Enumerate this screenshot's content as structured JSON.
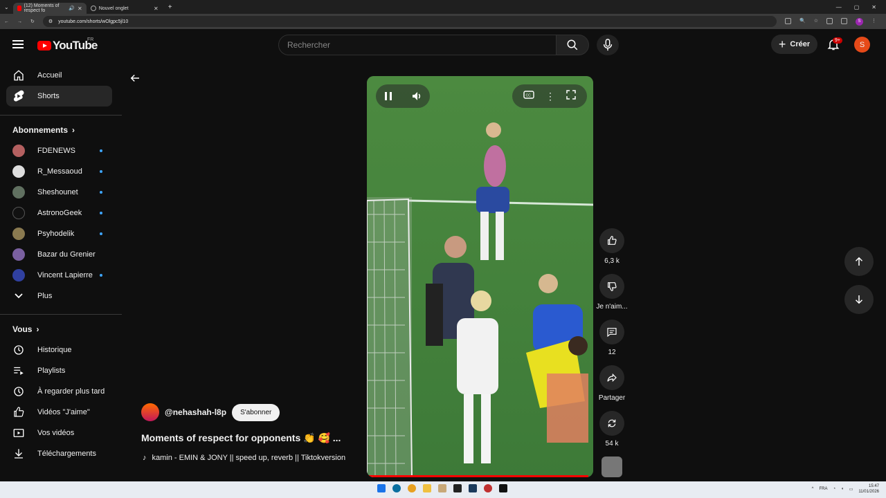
{
  "browser": {
    "tabs": [
      {
        "title": "(12) Moments of respect fo",
        "active": true
      },
      {
        "title": "Nouvel onglet",
        "active": false
      }
    ],
    "url": "youtube.com/shorts/wOlgpc5jl10"
  },
  "header": {
    "logo_text": "YouTube",
    "region": "FR",
    "search_placeholder": "Rechercher",
    "create_label": "Créer",
    "notification_badge": "9+",
    "avatar_letter": "S"
  },
  "sidebar": {
    "main": [
      {
        "label": "Accueil",
        "icon": "home-icon"
      },
      {
        "label": "Shorts",
        "icon": "shorts-icon"
      }
    ],
    "subs_header": "Abonnements",
    "subscriptions": [
      {
        "label": "FDENEWS",
        "color": "#b46060",
        "new": true
      },
      {
        "label": "R_Messaoud",
        "color": "#dddddd",
        "new": true
      },
      {
        "label": "Sheshounet",
        "color": "#607060",
        "new": true
      },
      {
        "label": "AstronoGeek",
        "color": "#111111",
        "new": true
      },
      {
        "label": "Psyhodelik",
        "color": "#8a7a50",
        "new": true
      },
      {
        "label": "Bazar du Grenier",
        "color": "#7a60a0",
        "new": false
      },
      {
        "label": "Vincent Lapierre",
        "color": "#3040a0",
        "new": true
      }
    ],
    "more_label": "Plus",
    "you_header": "Vous",
    "you_items": [
      {
        "label": "Historique",
        "icon": "history-icon"
      },
      {
        "label": "Playlists",
        "icon": "playlists-icon"
      },
      {
        "label": "À regarder plus tard",
        "icon": "watch-later-icon"
      },
      {
        "label": "Vidéos \"J'aime\"",
        "icon": "liked-icon"
      },
      {
        "label": "Vos vidéos",
        "icon": "your-videos-icon"
      },
      {
        "label": "Téléchargements",
        "icon": "download-icon"
      }
    ]
  },
  "short": {
    "channel": "@nehashah-l8p",
    "subscribe_label": "S'abonner",
    "title": "Moments of respect for opponents 👏 🥰 ...",
    "music": "kamin - EMIN & JONY || speed up, reverb || Tiktokversion",
    "progress": 0.98
  },
  "actions": {
    "likes": "6,3 k",
    "dislike_label": "Je n'aim...",
    "comments": "12",
    "share_label": "Partager",
    "remix": "54 k"
  },
  "taskbar": {
    "lang": "FRA",
    "time": "15:47",
    "date": "11/01/2026"
  }
}
